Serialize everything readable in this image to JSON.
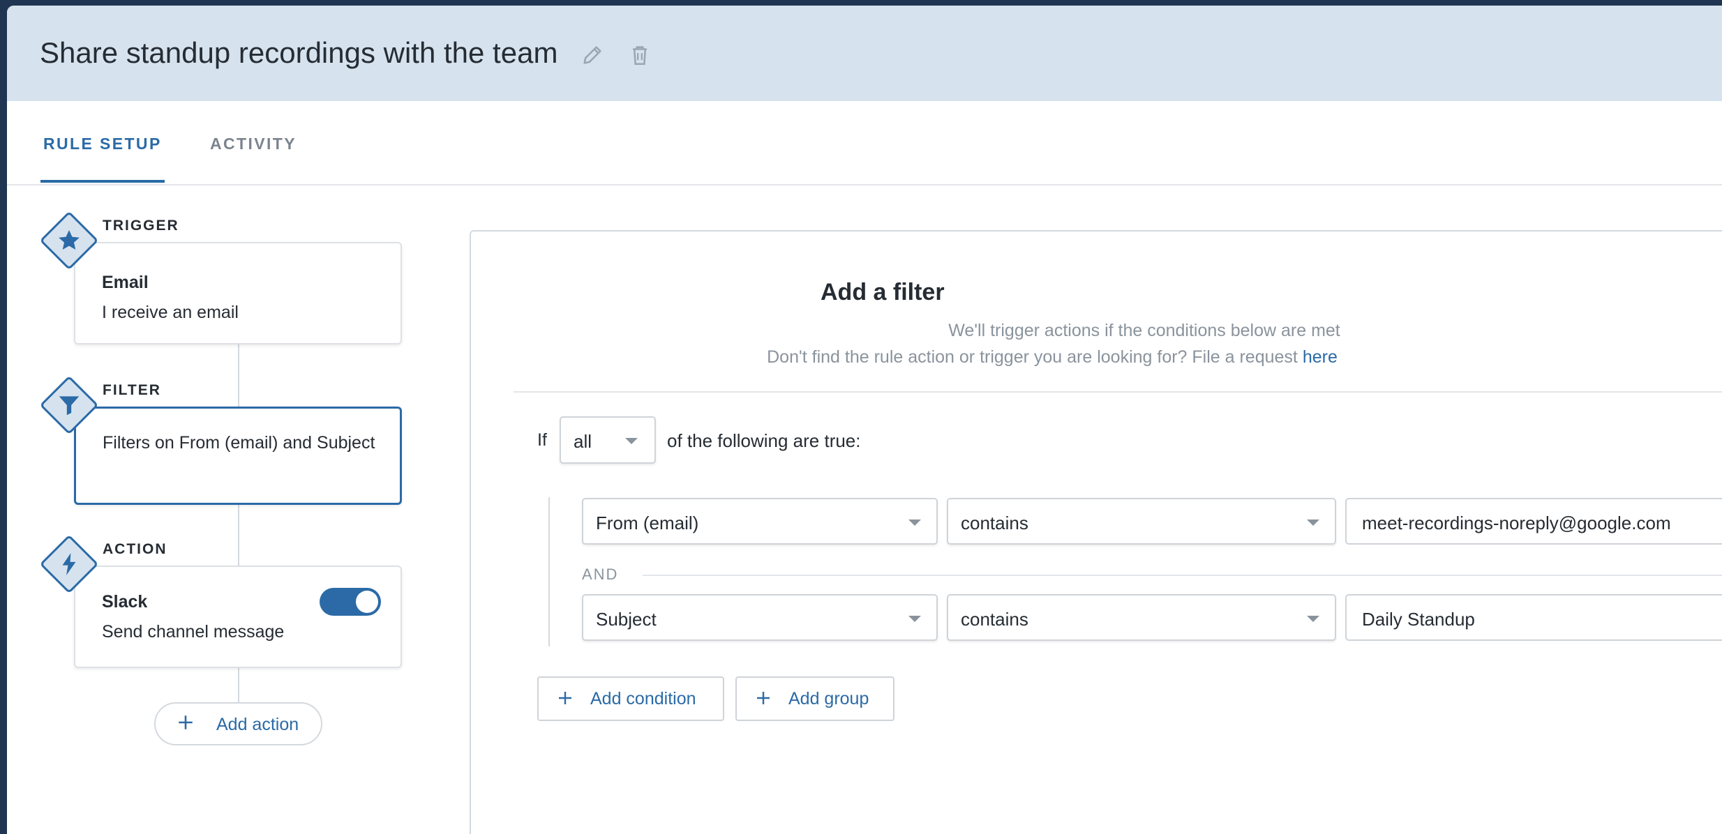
{
  "header": {
    "title": "Share standup recordings with the team"
  },
  "tabs": [
    {
      "label": "RULE SETUP",
      "active": true
    },
    {
      "label": "ACTIVITY",
      "active": false
    }
  ],
  "steps": {
    "trigger": {
      "label": "TRIGGER",
      "title": "Email",
      "subtitle": "I receive an email",
      "icon": "star-icon"
    },
    "filter": {
      "label": "FILTER",
      "subtitle": "Filters on From (email) and Subject",
      "icon": "funnel-icon"
    },
    "action": {
      "label": "ACTION",
      "title": "Slack",
      "subtitle": "Send channel message",
      "icon": "lightning-icon",
      "enabled": true
    }
  },
  "add_action_label": "Add action",
  "filter_panel": {
    "title": "Add a filter",
    "subtitle": "We'll trigger actions if the conditions below are met",
    "request_text": "Don't find the rule action or trigger you are looking for? File a request ",
    "request_link": "here",
    "if_label": "If",
    "match_select": "all",
    "following_text": "of the following are true:",
    "conditions": [
      {
        "field": "From (email)",
        "operator": "contains",
        "value": "meet-recordings-noreply@google.com"
      },
      {
        "field": "Subject",
        "operator": "contains",
        "value": "Daily Standup"
      }
    ],
    "join_label": "AND",
    "add_condition_label": "Add condition",
    "add_group_label": "Add group"
  },
  "colors": {
    "accent": "#2b6aa6",
    "header_bg": "#d6e3ef",
    "muted": "#8a939c"
  }
}
